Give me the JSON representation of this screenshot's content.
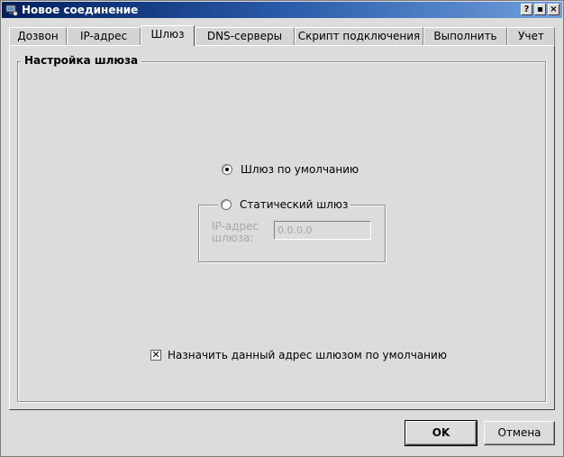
{
  "window": {
    "title": "Новое соединение",
    "title_buttons": [
      {
        "label": "?"
      },
      {
        "label": "▪"
      },
      {
        "label": "×"
      }
    ]
  },
  "tabs": [
    {
      "label": "Дозвон"
    },
    {
      "label": "IP-адрес"
    },
    {
      "label": "Шлюз",
      "active": true
    },
    {
      "label": "DNS-серверы"
    },
    {
      "label": "Скрипт подключения"
    },
    {
      "label": "Выполнить"
    },
    {
      "label": "Учет"
    }
  ],
  "gateway": {
    "group_title": "Настройка шлюза",
    "default_gateway_label": "Шлюз по умолчанию",
    "default_gateway_selected": true,
    "static_gateway_label": "Статический шлюз",
    "static_gateway_selected": false,
    "ip_label": "IP-адрес шлюза:",
    "ip_value": "0.0.0.0",
    "assign_default_label": "Назначить данный адрес шлюзом по умолчанию",
    "assign_default_checked": true,
    "checkbox_mark": "✕"
  },
  "buttons": {
    "ok": "OK",
    "cancel": "Отмена"
  }
}
